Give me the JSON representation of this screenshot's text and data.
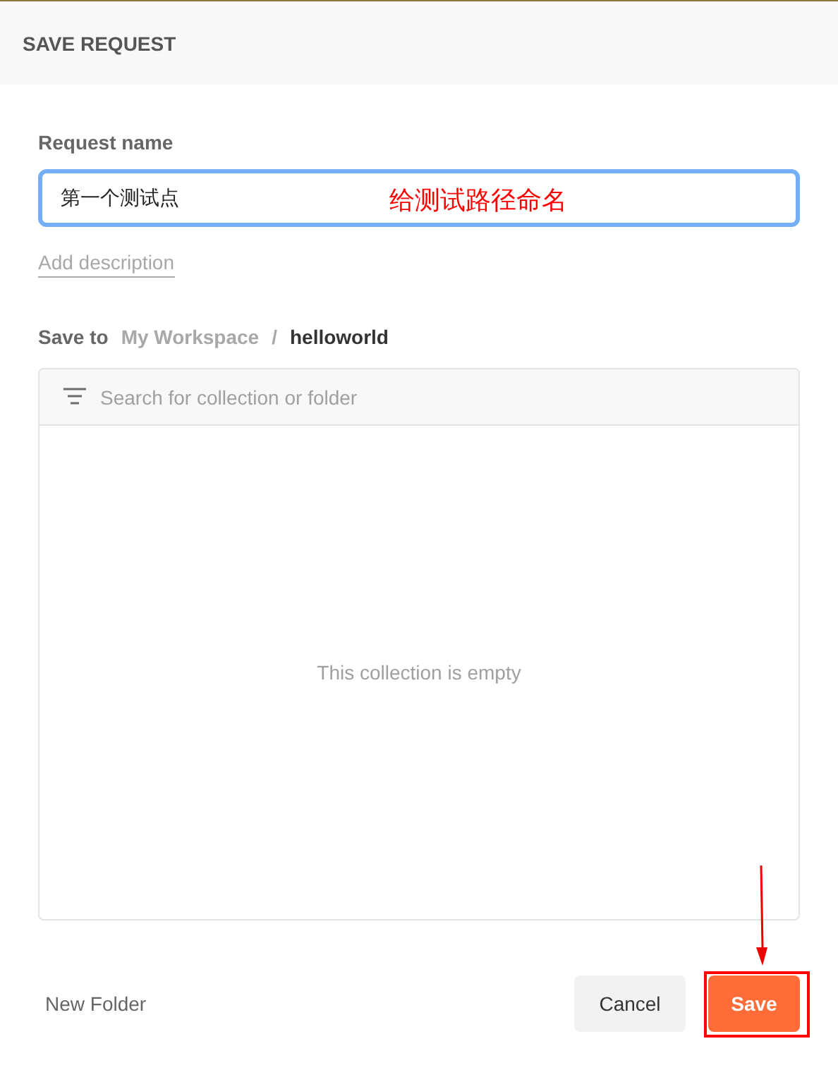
{
  "dialog": {
    "title": "SAVE REQUEST"
  },
  "request_name": {
    "label": "Request name",
    "value": "第一个测试点"
  },
  "add_description": "Add description",
  "save_to": {
    "label": "Save to",
    "workspace": "My Workspace",
    "separator": "/",
    "collection": "helloworld"
  },
  "search": {
    "placeholder": "Search for collection or folder"
  },
  "empty_message": "This collection is empty",
  "footer": {
    "new_folder": "New Folder",
    "cancel": "Cancel",
    "save": "Save"
  },
  "annotations": [
    {
      "kind": "text",
      "text": "给测试路径命名"
    },
    {
      "kind": "arrow"
    },
    {
      "kind": "box"
    }
  ]
}
